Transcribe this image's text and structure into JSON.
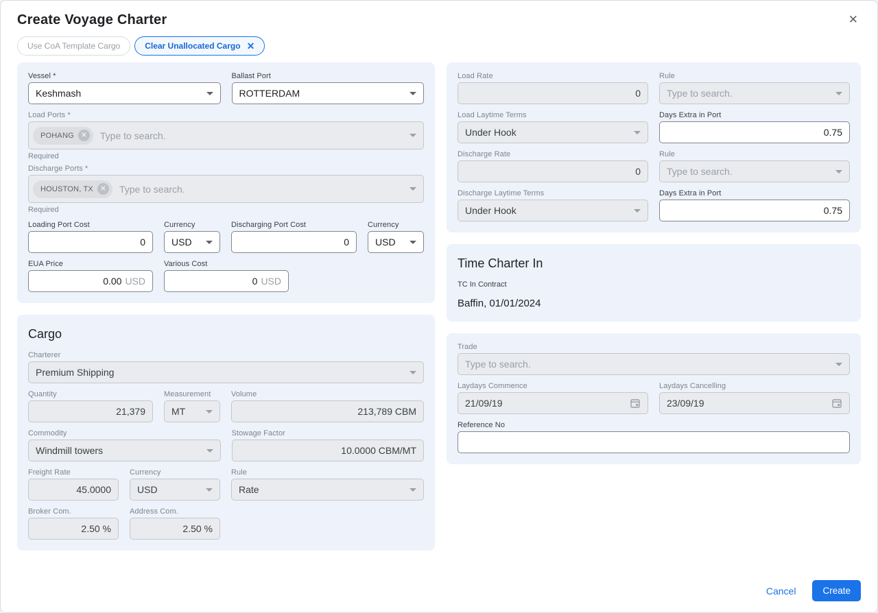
{
  "dialog": {
    "title": "Create Voyage Charter"
  },
  "icons": {
    "close": "✕",
    "chip_close": "✕",
    "chip_remove": "✕"
  },
  "colors": {
    "accent": "#1a73e8",
    "panel_bg": "#edf2fb",
    "disabled_bg": "#e9ebee",
    "chip_bg": "#dcdee1"
  },
  "chips": {
    "coa_template": "Use CoA Template Cargo",
    "clear_unallocated": "Clear Unallocated Cargo"
  },
  "left": {
    "vessel": {
      "label": "Vessel *",
      "value": "Keshmash"
    },
    "ballast_port": {
      "label": "Ballast Port",
      "value": "ROTTERDAM"
    },
    "load_ports": {
      "label": "Load Ports *",
      "chip": "POHANG",
      "placeholder": "Type to search.",
      "helper": "Required"
    },
    "discharge_ports": {
      "label": "Discharge Ports *",
      "chip": "HOUSTON, TX",
      "placeholder": "Type to search.",
      "helper": "Required"
    },
    "loading_port_cost": {
      "label": "Loading Port Cost",
      "value": "0"
    },
    "loading_currency": {
      "label": "Currency",
      "value": "USD"
    },
    "discharging_port_cost": {
      "label": "Discharging Port Cost",
      "value": "0"
    },
    "discharging_currency": {
      "label": "Currency",
      "value": "USD"
    },
    "eua_price": {
      "label": "EUA Price",
      "value": "0.00",
      "suffix": "USD"
    },
    "various_cost": {
      "label": "Various Cost",
      "value": "0",
      "suffix": "USD"
    }
  },
  "cargo": {
    "title": "Cargo",
    "charterer": {
      "label": "Charterer",
      "value": "Premium Shipping"
    },
    "quantity": {
      "label": "Quantity",
      "value": "21,379"
    },
    "measurement": {
      "label": "Measurement",
      "value": "MT"
    },
    "volume": {
      "label": "Volume",
      "value": "213,789 CBM"
    },
    "commodity": {
      "label": "Commodity",
      "value": "Windmill towers"
    },
    "stowage_factor": {
      "label": "Stowage Factor",
      "value": "10.0000 CBM/MT"
    },
    "freight_rate": {
      "label": "Freight Rate",
      "value": "45.0000"
    },
    "freight_currency": {
      "label": "Currency",
      "value": "USD"
    },
    "rule": {
      "label": "Rule",
      "value": "Rate"
    },
    "broker_com": {
      "label": "Broker Com.",
      "value": "2.50 %"
    },
    "address_com": {
      "label": "Address Com.",
      "value": "2.50 %"
    }
  },
  "rates": {
    "load_rate": {
      "label": "Load Rate",
      "value": "0"
    },
    "load_rule": {
      "label": "Rule",
      "placeholder": "Type to search."
    },
    "load_laytime": {
      "label": "Load Laytime Terms",
      "value": "Under Hook"
    },
    "load_days_extra": {
      "label": "Days Extra in Port",
      "value": "0.75"
    },
    "discharge_rate": {
      "label": "Discharge Rate",
      "value": "0"
    },
    "discharge_rule": {
      "label": "Rule",
      "placeholder": "Type to search."
    },
    "discharge_laytime": {
      "label": "Discharge Laytime Terms",
      "value": "Under Hook"
    },
    "discharge_days_extra": {
      "label": "Days Extra in Port",
      "value": "0.75"
    }
  },
  "time_charter_in": {
    "title": "Time Charter In",
    "contract_label": "TC In Contract",
    "contract_value": "Baffin, 01/01/2024"
  },
  "trade": {
    "trade": {
      "label": "Trade",
      "placeholder": "Type to search."
    },
    "laydays_commence": {
      "label": "Laydays Commence",
      "value": "21/09/19"
    },
    "laydays_cancelling": {
      "label": "Laydays Cancelling",
      "value": "23/09/19"
    },
    "reference_no": {
      "label": "Reference No",
      "value": ""
    }
  },
  "footer": {
    "cancel": "Cancel",
    "create": "Create"
  }
}
